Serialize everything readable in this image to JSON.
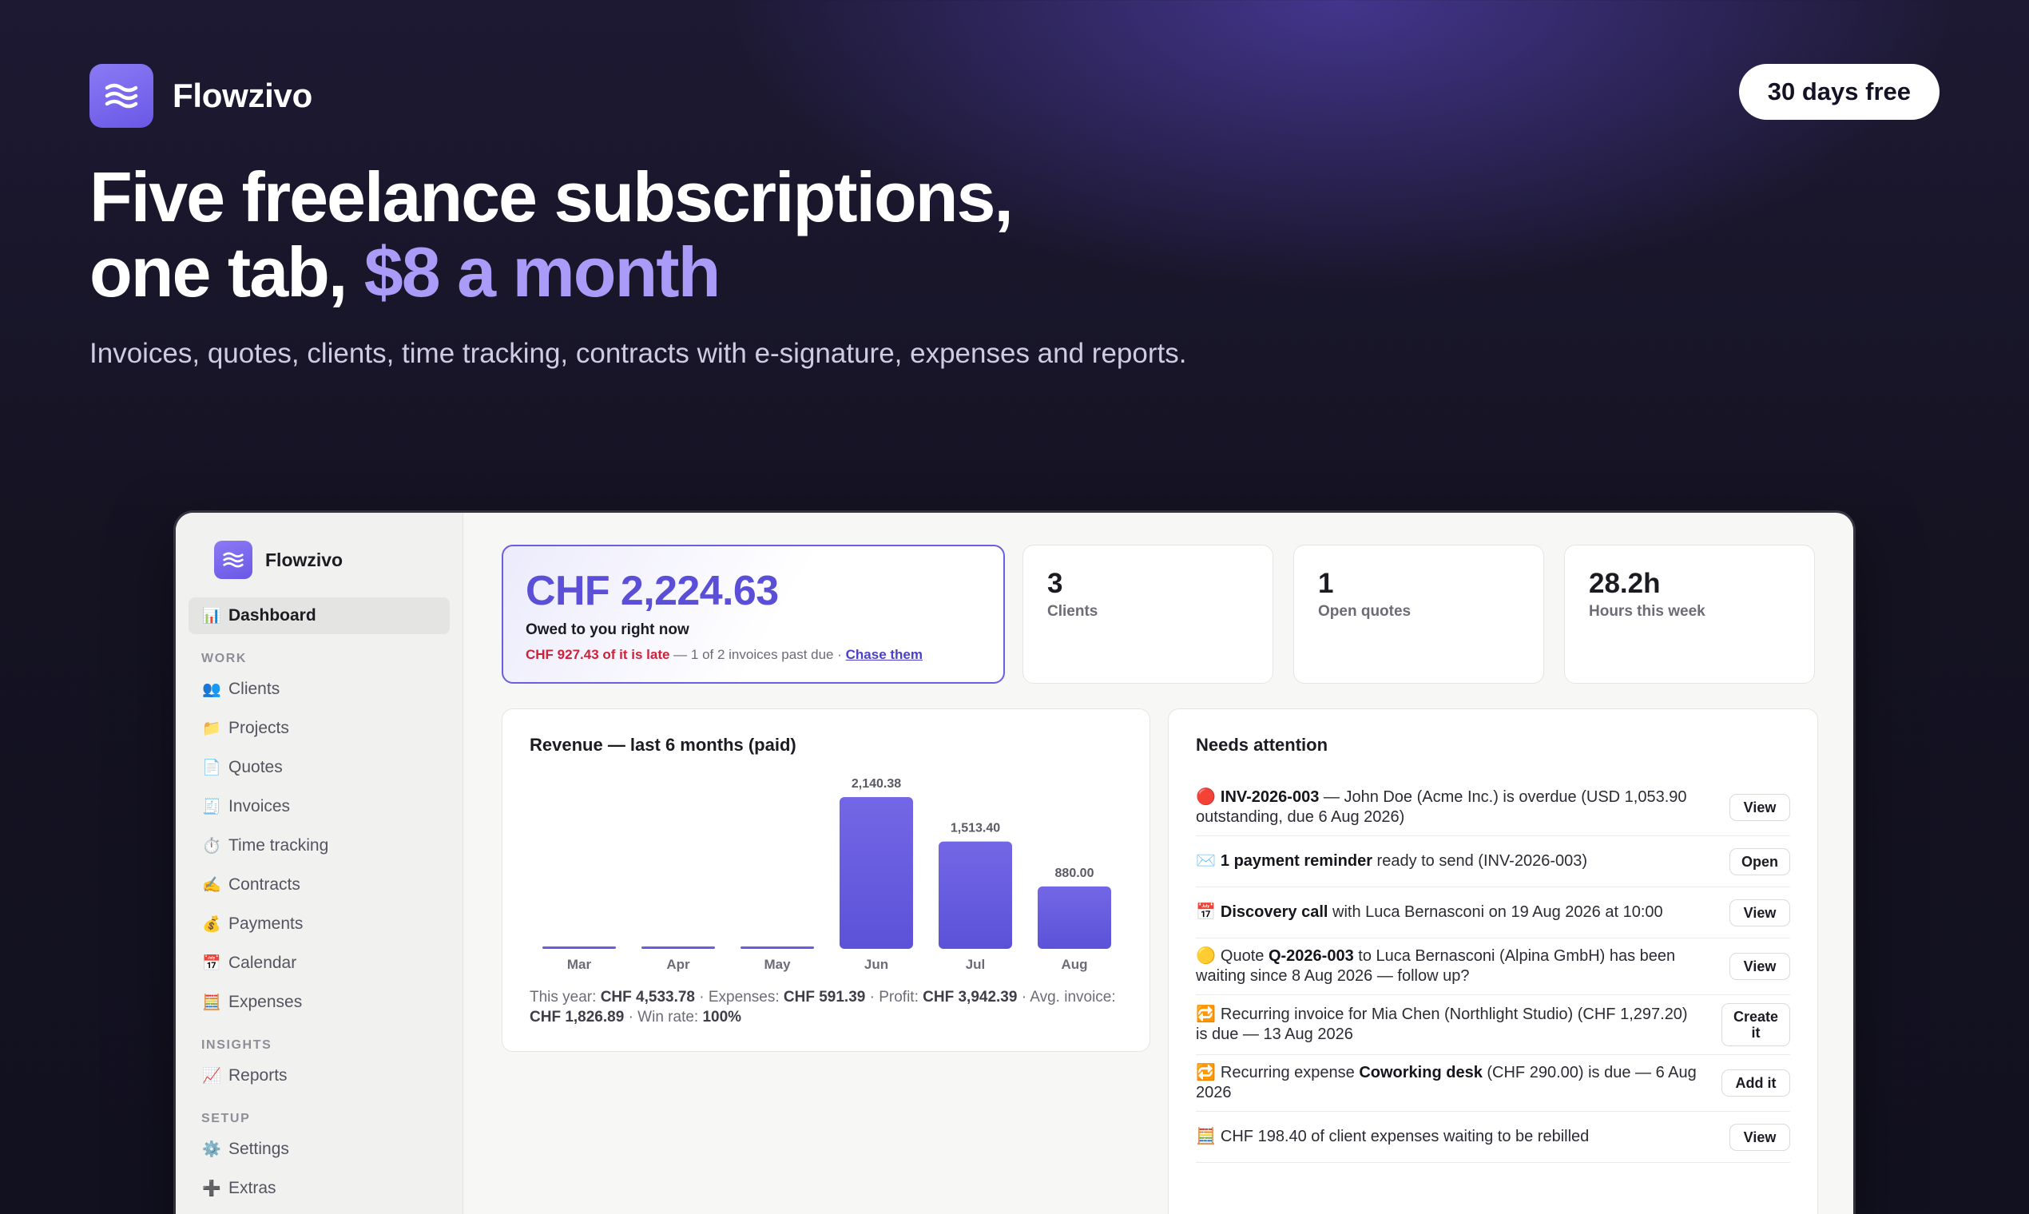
{
  "brand": {
    "name": "Flowzivo",
    "cta": "30 days free"
  },
  "hero": {
    "headline_line1": "Five freelance subscriptions,",
    "headline_line2_prefix": "one tab, ",
    "headline_line2_accent": "$8 a month",
    "subhead": "Invoices, quotes, clients, time tracking, contracts with e-signature, expenses and reports."
  },
  "sidebar": {
    "brand": "Flowzivo",
    "active": {
      "icon": "📊",
      "label": "Dashboard"
    },
    "groups": [
      {
        "title": "WORK",
        "items": [
          {
            "icon": "👥",
            "label": "Clients"
          },
          {
            "icon": "📁",
            "label": "Projects"
          },
          {
            "icon": "📄",
            "label": "Quotes"
          },
          {
            "icon": "🧾",
            "label": "Invoices"
          },
          {
            "icon": "⏱️",
            "label": "Time tracking"
          },
          {
            "icon": "✍️",
            "label": "Contracts"
          },
          {
            "icon": "💰",
            "label": "Payments"
          },
          {
            "icon": "📅",
            "label": "Calendar"
          },
          {
            "icon": "🧮",
            "label": "Expenses"
          }
        ]
      },
      {
        "title": "INSIGHTS",
        "items": [
          {
            "icon": "📈",
            "label": "Reports"
          }
        ]
      },
      {
        "title": "SETUP",
        "items": [
          {
            "icon": "⚙️",
            "label": "Settings"
          },
          {
            "icon": "➕",
            "label": "Extras"
          }
        ]
      }
    ]
  },
  "owed": {
    "amount": "CHF 2,224.63",
    "label": "Owed to you right now",
    "late": "CHF 927.43 of it is late",
    "note": " — 1 of 2 invoices past due · ",
    "link": "Chase them"
  },
  "stats": [
    {
      "value": "3",
      "label": "Clients"
    },
    {
      "value": "1",
      "label": "Open quotes"
    },
    {
      "value": "28.2h",
      "label": "Hours this week"
    }
  ],
  "revenue": {
    "title": "Revenue — last 6 months (paid)",
    "footer": {
      "this_year_label": "This year: ",
      "this_year": "CHF 4,533.78",
      "expenses_label": " · Expenses: ",
      "expenses": "CHF 591.39",
      "profit_label": " · Profit: ",
      "profit": "CHF 3,942.39",
      "avg_label": " · Avg. invoice: ",
      "avg": "CHF 1,826.89",
      "win_label": " · Win rate: ",
      "win": "100%"
    }
  },
  "chart_data": {
    "type": "bar",
    "title": "Revenue — last 6 months (paid)",
    "categories": [
      "Mar",
      "Apr",
      "May",
      "Jun",
      "Jul",
      "Aug"
    ],
    "values": [
      0,
      0,
      0,
      2140.38,
      1513.4,
      880.0
    ],
    "data_labels": [
      "",
      "",
      "",
      "2,140.38",
      "1,513.40",
      "880.00"
    ],
    "ylim": [
      0,
      2140.38
    ],
    "bar_color": "#6a5fe0",
    "grid": false,
    "legend": "none"
  },
  "attention": {
    "title": "Needs attention",
    "items": [
      {
        "icon": "🔴",
        "bold": "INV-2026-003",
        "text": " — John Doe (Acme Inc.) is overdue (USD 1,053.90 outstanding, due 6 Aug 2026)",
        "button": "View"
      },
      {
        "icon": "✉️",
        "bold": "1 payment reminder",
        "text": " ready to send (INV-2026-003)",
        "button": "Open"
      },
      {
        "icon": "📅",
        "bold": "Discovery call",
        "text": " with Luca Bernasconi on 19 Aug 2026 at 10:00",
        "button": "View"
      },
      {
        "icon": "🟡",
        "pre": "Quote ",
        "bold": "Q-2026-003",
        "text": " to Luca Bernasconi (Alpina GmbH) has been waiting since 8 Aug 2026 — follow up?",
        "button": "View"
      },
      {
        "icon": "🔁",
        "pre": "Recurring invoice for Mia Chen (Northlight Studio) (CHF 1,297.20) is due — 13 Aug 2026",
        "bold": "",
        "text": "",
        "button": "Create it"
      },
      {
        "icon": "🔁",
        "pre": "Recurring expense ",
        "bold": "Coworking desk",
        "text": " (CHF 290.00) is due — 6 Aug 2026",
        "button": "Add it"
      },
      {
        "icon": "🧮",
        "pre": "CHF 198.40 of client expenses waiting to be rebilled",
        "bold": "",
        "text": "",
        "button": "View"
      }
    ]
  },
  "colors": {
    "accent": "#6a5fe0",
    "late": "#d1203a",
    "background": "#151322"
  }
}
